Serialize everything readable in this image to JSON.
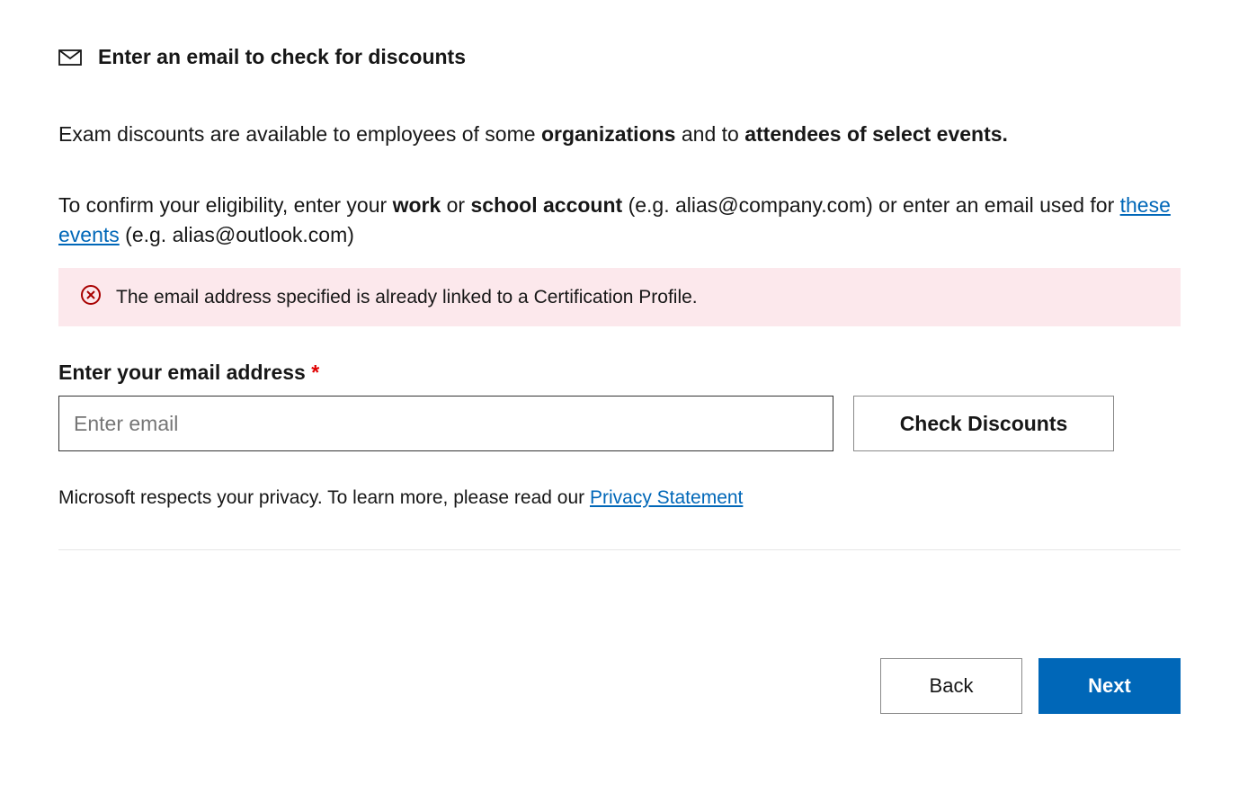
{
  "header": {
    "title": "Enter an email to check for discounts"
  },
  "description": {
    "part1": "Exam discounts are available to employees of some ",
    "bold1": "organizations",
    "part2": " and to ",
    "bold2": "attendees of select events."
  },
  "eligibility": {
    "part1": "To confirm your eligibility, enter your ",
    "bold1": "work",
    "part2": " or ",
    "bold2": "school account",
    "part3": " (e.g. alias@company.com) or enter an email used for ",
    "link_text": "these events",
    "part4": " (e.g. alias@outlook.com)"
  },
  "error": {
    "message": "The email address specified is already linked to a Certification Profile."
  },
  "field": {
    "label": "Enter your email address",
    "asterisk": "*",
    "placeholder": "Enter email"
  },
  "buttons": {
    "check": "Check Discounts",
    "back": "Back",
    "next": "Next"
  },
  "privacy": {
    "text": "Microsoft respects your privacy. To learn more, please read our ",
    "link_text": "Privacy Statement"
  }
}
